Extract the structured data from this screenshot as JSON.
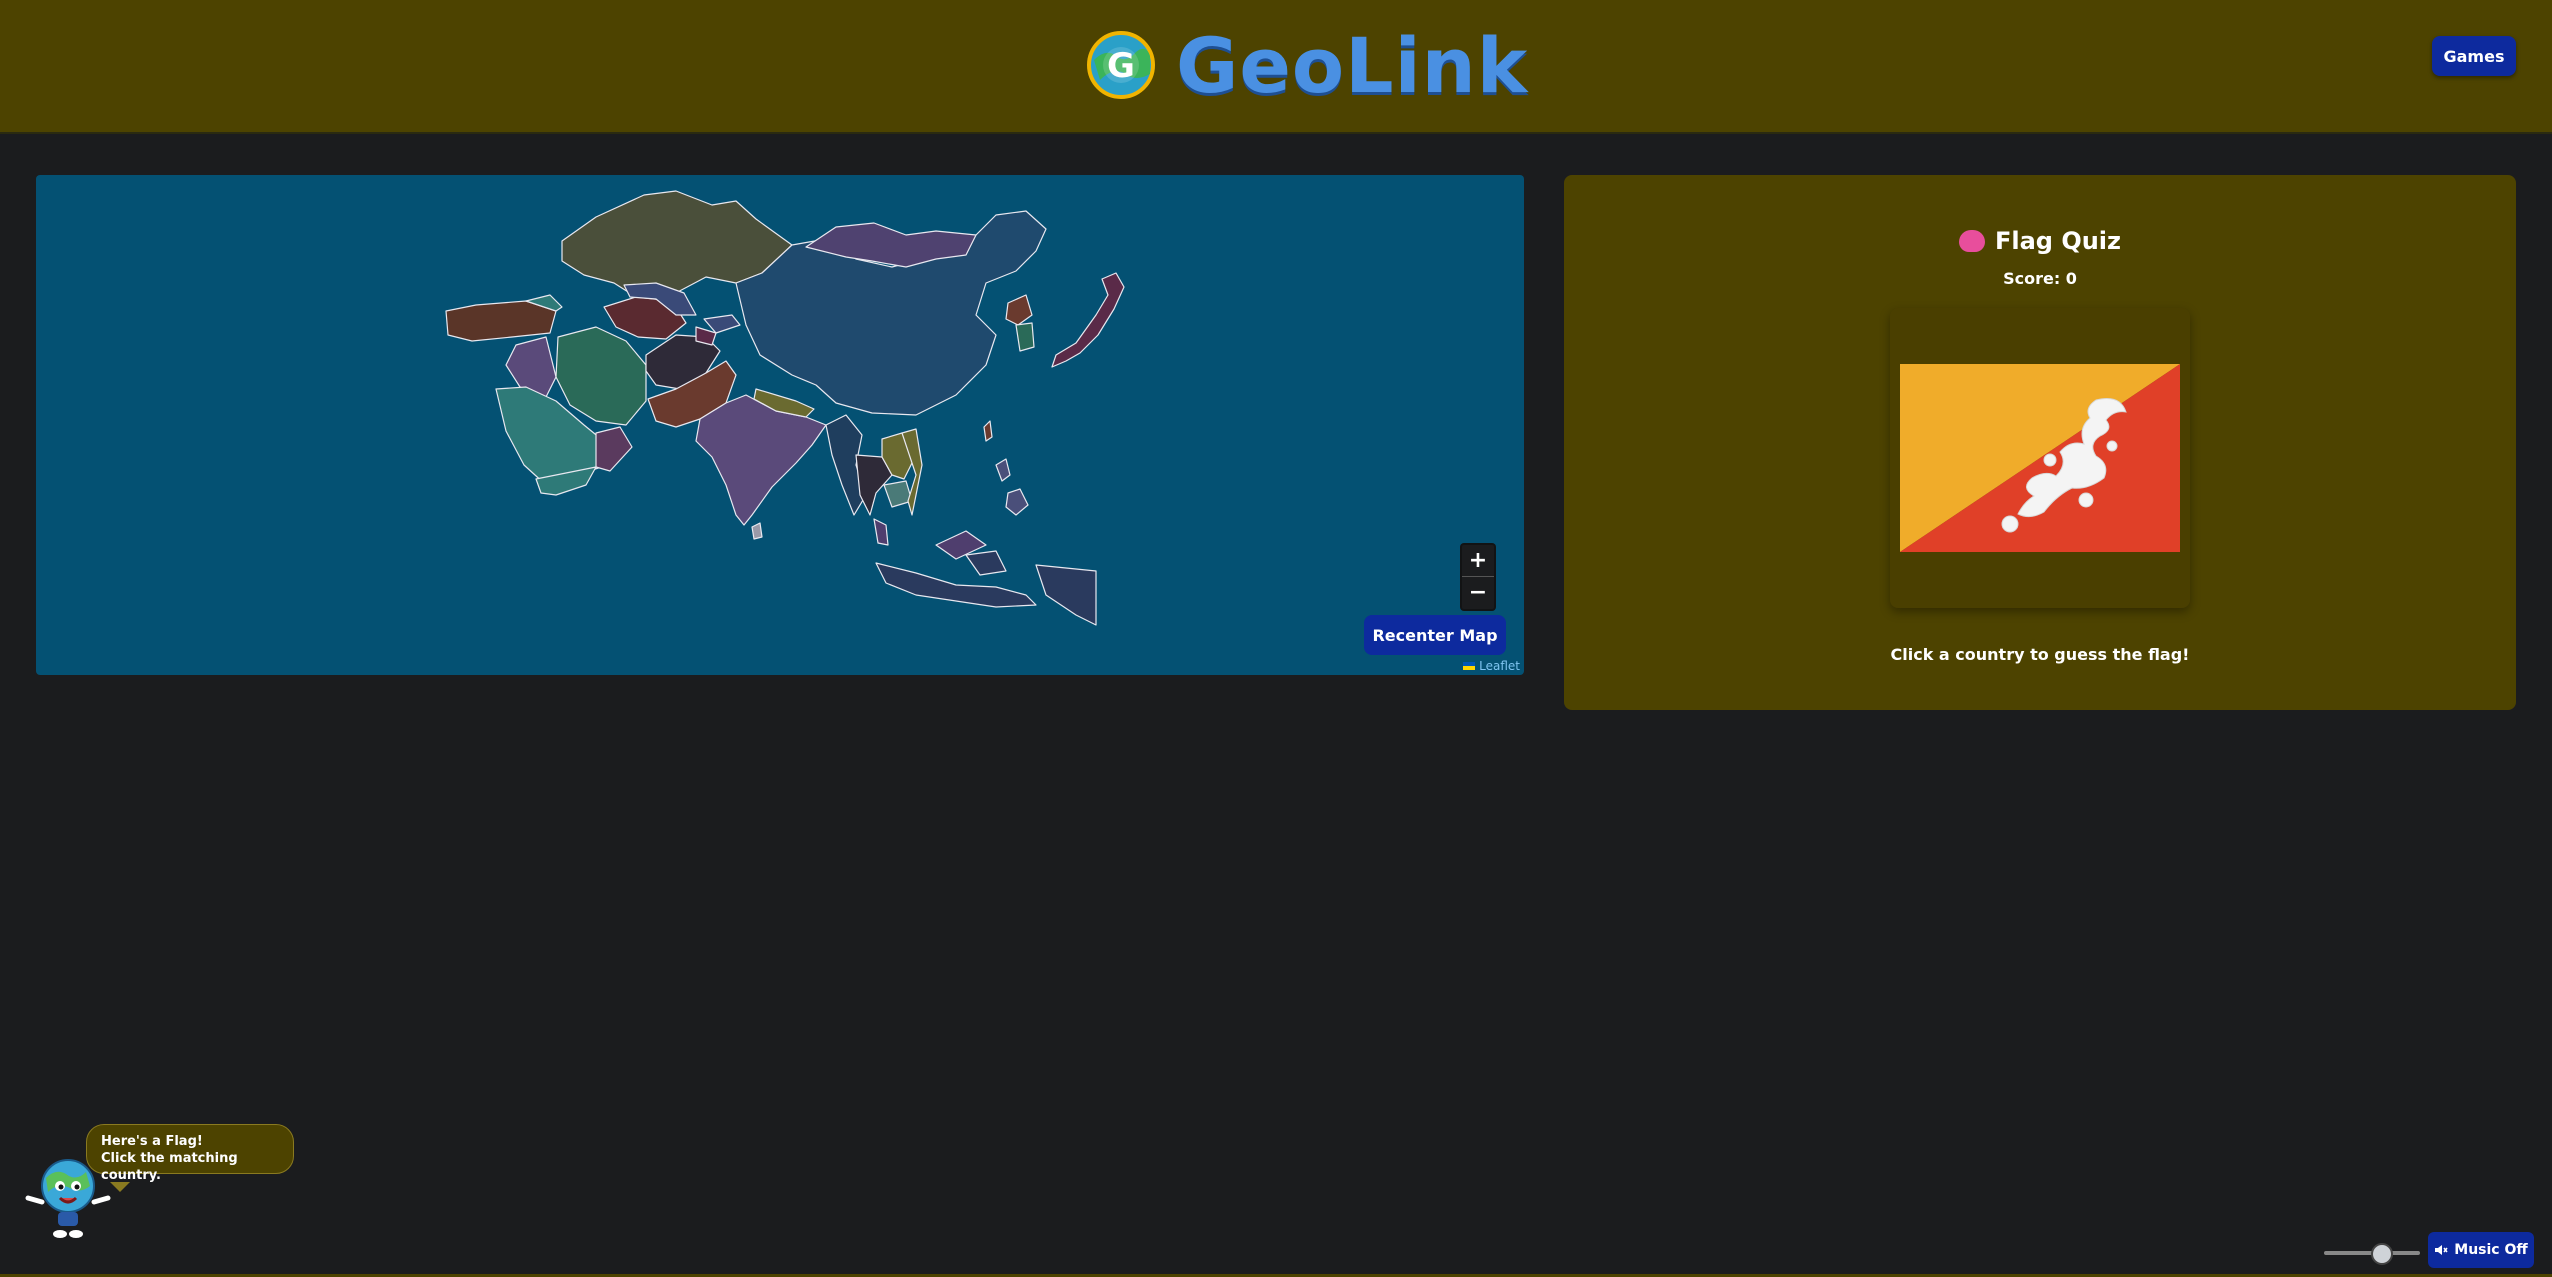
{
  "header": {
    "logo_letter": "G",
    "app_title": "GeoLink",
    "games_label": "Games"
  },
  "map": {
    "zoom_in_label": "+",
    "zoom_out_label": "−",
    "recenter_label": "Recenter Map",
    "attribution": "Leaflet"
  },
  "quiz": {
    "title": "Flag Quiz",
    "score_text": "Score: 0",
    "flag_depicted": "Bhutan",
    "hint": "Click a country to guess the flag!"
  },
  "mascot": {
    "line1": "Here's a Flag!",
    "line2": "Click the matching country."
  },
  "audio": {
    "music_label": "Music Off",
    "volume_level": 0.6
  },
  "colors": {
    "header_bg": "#4d4300",
    "page_bg": "#1b1c1e",
    "map_ocean": "#045173",
    "button_blue": "#0d2a9e",
    "logo_blue": "#4a90e2"
  },
  "icons": {
    "quiz_icon": "brain-icon",
    "music_icon": "speaker-muted-icon"
  }
}
